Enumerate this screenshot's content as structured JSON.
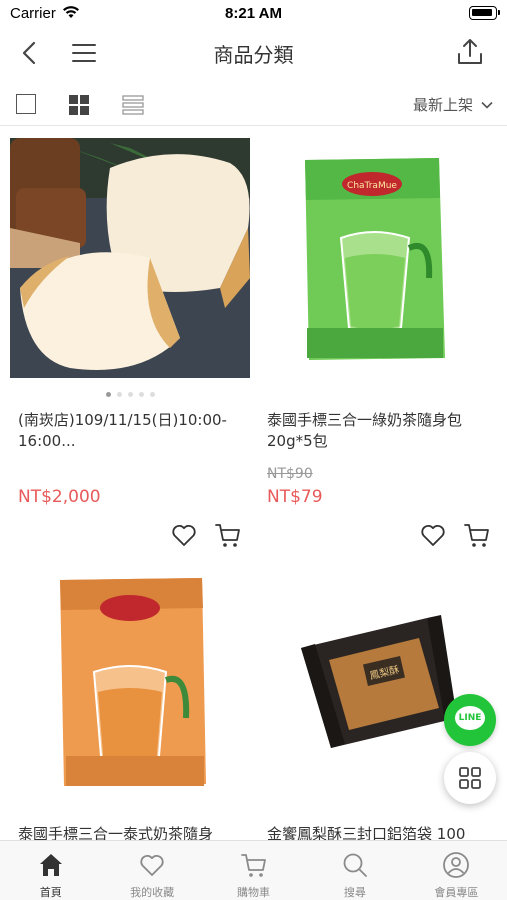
{
  "status": {
    "carrier": "Carrier",
    "time": "8:21 AM"
  },
  "nav": {
    "title": "商品分類"
  },
  "toolbar": {
    "sort_label": "最新上架"
  },
  "products": [
    {
      "title": "(南崁店)109/11/15(日)10:00-16:00...",
      "old_price": "",
      "price": "NT$2,000"
    },
    {
      "title": "泰國手標三合一綠奶茶隨身包20g*5包",
      "old_price": "NT$90",
      "price": "NT$79"
    },
    {
      "title": "泰國手標三合一泰式奶茶隨身",
      "old_price": "",
      "price": ""
    },
    {
      "title": "金饗鳳梨酥三封口鋁箔袋 100",
      "old_price": "",
      "price": ""
    }
  ],
  "product_images": {
    "p2_brand": "ChaTraMue",
    "p4_label": "鳳梨酥"
  },
  "floating": {
    "line_label": "LINE"
  },
  "tabs": [
    {
      "label": "首頁"
    },
    {
      "label": "我的收藏"
    },
    {
      "label": "購物車"
    },
    {
      "label": "搜尋"
    },
    {
      "label": "會員專區"
    }
  ],
  "colors": {
    "price": "#e85a5a",
    "line_green": "#22c43a",
    "tab_active": "#333333",
    "tab_inactive": "#8a8a8a"
  },
  "icons": {
    "nav": [
      "back-icon",
      "menu-icon",
      "share-icon"
    ],
    "toolbar": [
      "single-view-icon",
      "grid-view-icon",
      "list-view-icon",
      "chevron-down-icon"
    ],
    "card": [
      "heart-icon",
      "cart-icon"
    ],
    "tabs": [
      "home-icon",
      "heart-icon",
      "cart-icon",
      "search-icon",
      "user-icon"
    ]
  }
}
